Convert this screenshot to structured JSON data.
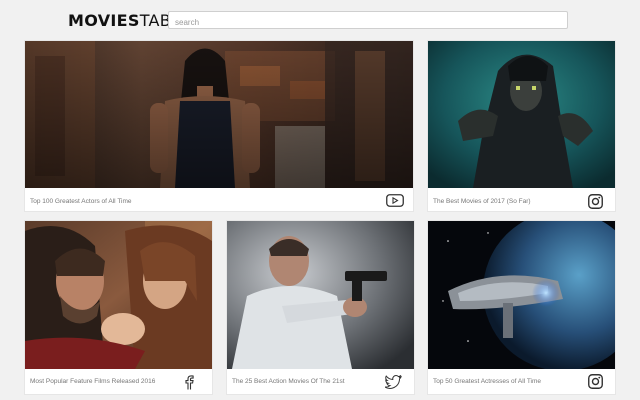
{
  "header": {
    "logo_bold": "MOVIES",
    "logo_light": "TAB",
    "search_placeholder": "search"
  },
  "cards": [
    {
      "caption": "Top 100 Greatest Actors of All Time",
      "social_icon": "youtube-icon"
    },
    {
      "caption": "The Best Movies of 2017 (So Far)",
      "social_icon": "instagram-icon"
    },
    {
      "caption": "Most Popular Feature Films Released 2016",
      "social_icon": "facebook-icon"
    },
    {
      "caption": "The 25 Best Action Movies Of The 21st",
      "social_icon": "twitter-icon"
    },
    {
      "caption": "Top 50 Greatest Actresses of All Time",
      "social_icon": "instagram-icon"
    }
  ],
  "colors": {
    "background": "#f1f1f1",
    "card": "#ffffff",
    "caption_text": "#777777",
    "icon": "#333333"
  }
}
